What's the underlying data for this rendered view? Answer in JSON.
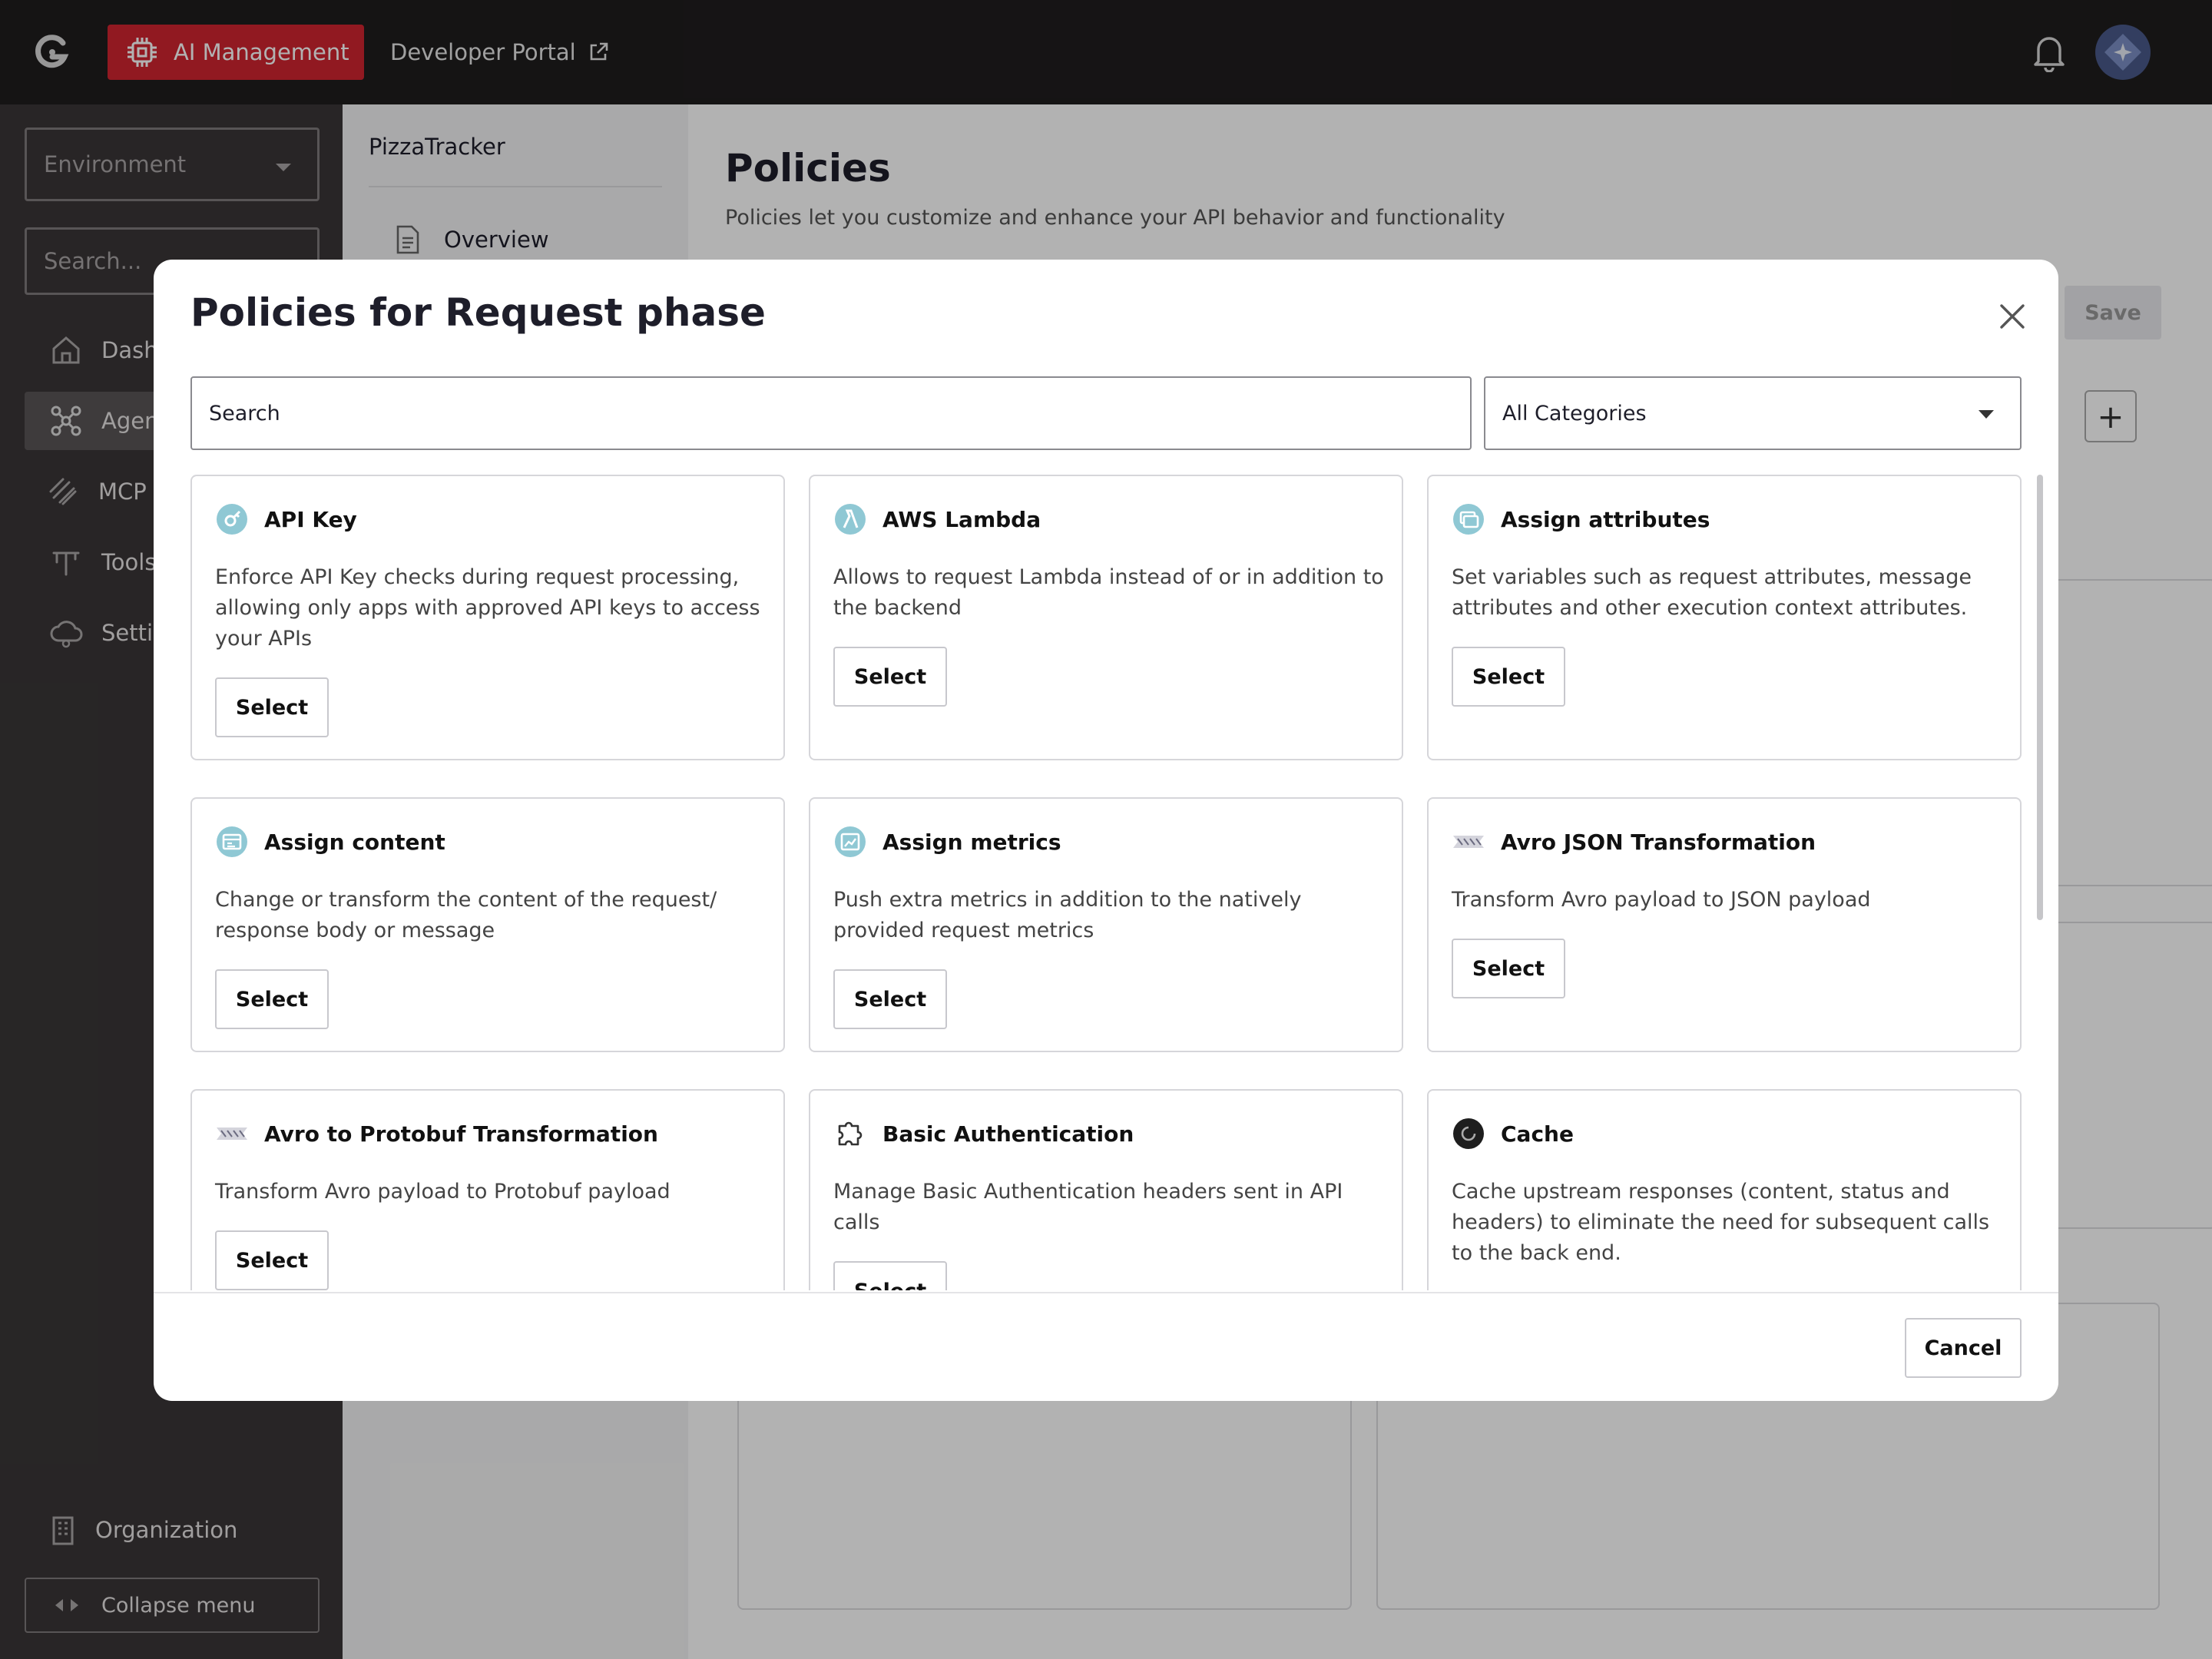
{
  "topbar": {
    "app_button_label": "AI Management",
    "developer_portal_label": "Developer Portal"
  },
  "leftnav": {
    "environment_placeholder": "Environment",
    "search_placeholder": "Search...",
    "items": [
      {
        "label": "Dashboard",
        "icon": "home-icon"
      },
      {
        "label": "Agents",
        "icon": "agents-icon"
      },
      {
        "label": "MCP Servers",
        "icon": "mcp-icon"
      },
      {
        "label": "Tools",
        "icon": "tools-icon"
      },
      {
        "label": "Settings",
        "icon": "cloud-settings-icon"
      }
    ],
    "organization_label": "Organization",
    "collapse_label": "Collapse menu"
  },
  "secnav": {
    "title": "PizzaTracker",
    "overview_label": "Overview"
  },
  "main": {
    "title": "Policies",
    "subtitle": "Policies let you customize and enhance your API behavior and functionality",
    "save_label": "Save"
  },
  "modal": {
    "title": "Policies for Request phase",
    "search_placeholder": "Search",
    "category_value": "All Categories",
    "select_label": "Select",
    "cancel_label": "Cancel",
    "policies": [
      {
        "title": "API Key",
        "description": "Enforce API Key checks during request processing, allowing only apps with approved API keys to access your APIs",
        "icon": "api-key-icon"
      },
      {
        "title": "AWS Lambda",
        "description": "Allows to request Lambda instead of or in addition to the backend",
        "icon": "aws-lambda-icon"
      },
      {
        "title": "Assign attributes",
        "description": "Set variables such as request attributes, message attributes and other execution context attributes.",
        "icon": "assign-attributes-icon"
      },
      {
        "title": "Assign content",
        "description": "Change or transform the content of the request/ response body or message",
        "icon": "assign-content-icon"
      },
      {
        "title": "Assign metrics",
        "description": "Push extra metrics in addition to the natively provided request metrics",
        "icon": "assign-metrics-icon"
      },
      {
        "title": "Avro JSON Transformation",
        "description": "Transform Avro payload to JSON payload",
        "icon": "avro-icon"
      },
      {
        "title": "Avro to Protobuf Transformation",
        "description": "Transform Avro payload to Protobuf payload",
        "icon": "avro-icon"
      },
      {
        "title": "Basic Authentication",
        "description": "Manage Basic Authentication headers sent in API calls",
        "icon": "puzzle-icon"
      },
      {
        "title": "Cache",
        "description": "Cache upstream responses (content, status and headers) to eliminate the need for subsequent calls to the back end.",
        "icon": "cache-icon"
      }
    ]
  }
}
